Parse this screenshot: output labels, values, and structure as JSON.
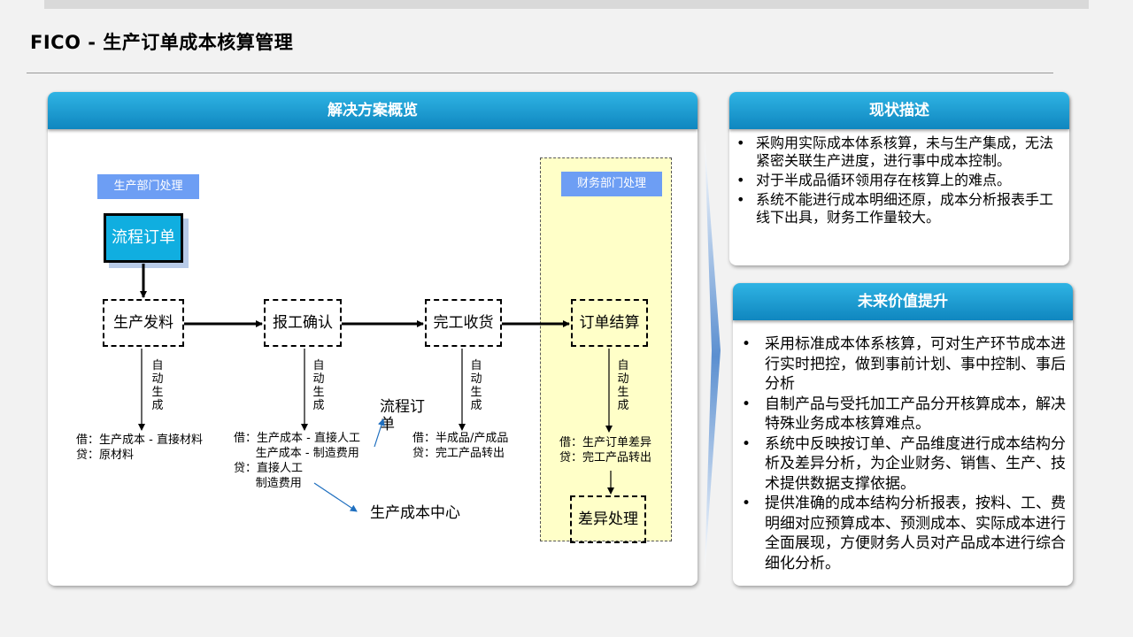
{
  "page": {
    "title": "FICO - 生产订单成本核算管理"
  },
  "solution": {
    "header": "解决方案概览",
    "production_dept_label": "生产部门处理",
    "finance_dept_label": "财务部门处理",
    "flow_order": "流程订单",
    "nodes": {
      "issue": "生产发料",
      "confirm": "报工确认",
      "receipt": "完工收货",
      "settle": "订单结算",
      "variance": "差异处理"
    },
    "auto_generate": "自动生成",
    "entries": {
      "issue": "借：生产成本 - 直接材料\n贷：原材料",
      "confirm": "借：生产成本 - 直接人工\n      生产成本 - 制造费用\n贷：直接人工\n      制造费用",
      "receipt": "借：半成品/产成品\n贷：完工产品转出",
      "settle": "借：生产订单差异\n贷：完工产品转出"
    },
    "flow_order_note": "流程订单",
    "cost_center_note": "生产成本中心"
  },
  "current": {
    "header": "现状描述",
    "bullet_char": "•",
    "items": [
      "采购用实际成本体系核算，未与生产集成，无法紧密关联生产进度，进行事中成本控制。",
      "对于半成品循环领用存在核算上的难点。",
      "系统不能进行成本明细还原，成本分析报表手工线下出具，财务工作量较大。"
    ]
  },
  "future": {
    "header": "未来价值提升",
    "bullet_char": "•",
    "items": [
      "采用标准成本体系核算，可对生产环节成本进行实时把控，做到事前计划、事中控制、事后分析",
      "自制产品与受托加工产品分开核算成本，解决特殊业务成本核算难点。",
      "系统中反映按订单、产品维度进行成本结构分析及差异分析，为企业财务、销售、生产、技术提供数据支撑依据。",
      "提供准确的成本结构分析报表，按料、工、费明细对应预算成本、预测成本、实际成本进行全面展现，方便财务人员对产品成本进行综合细化分析。"
    ]
  }
}
